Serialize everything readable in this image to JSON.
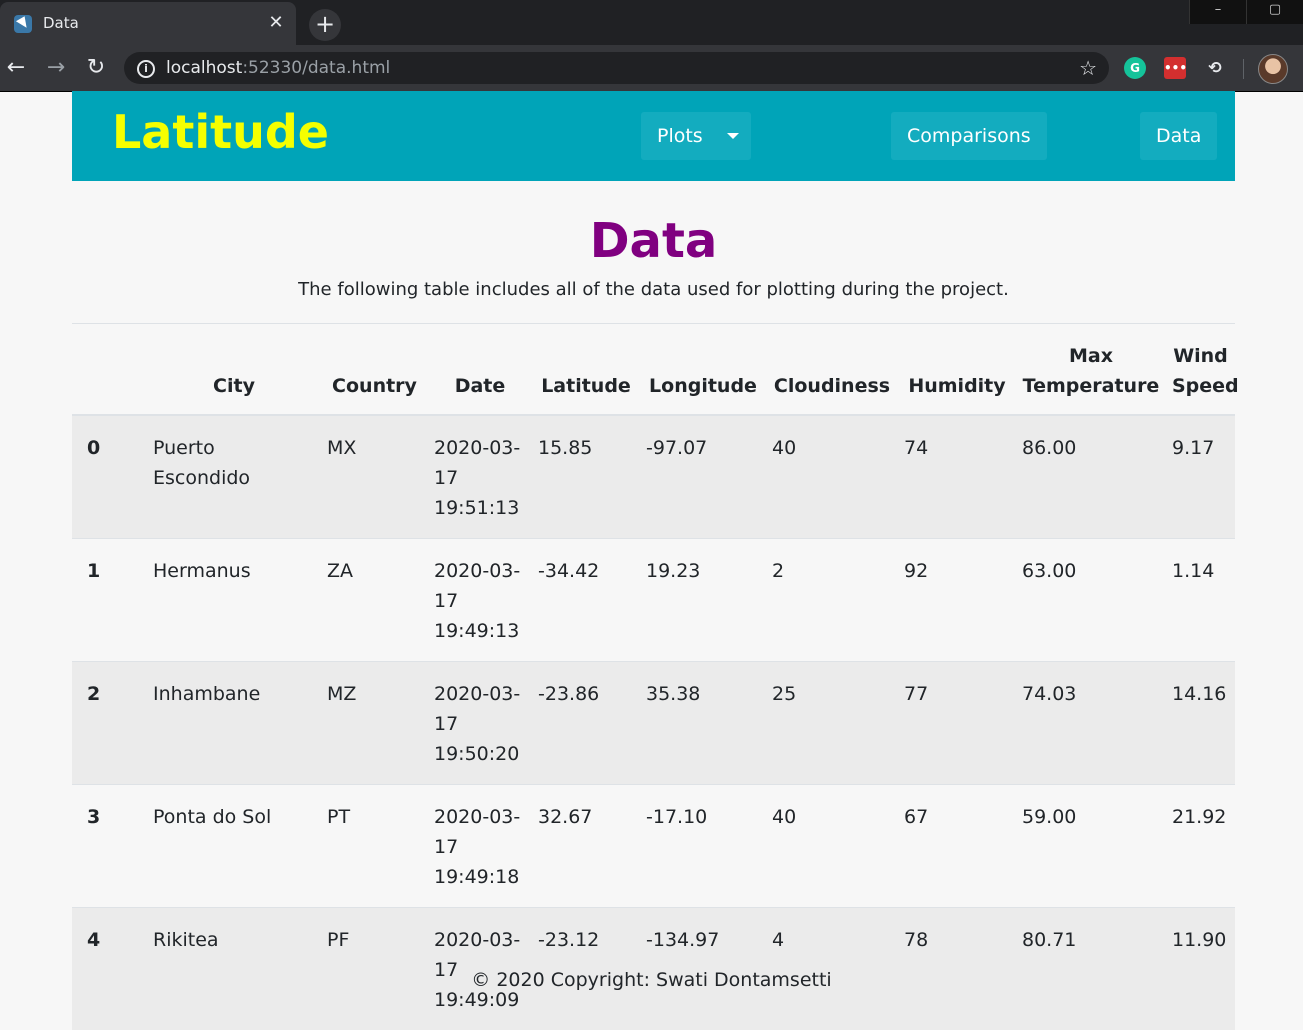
{
  "browser": {
    "tab_title": "Data",
    "close_glyph": "✕",
    "newtab_glyph": "+",
    "url_host": "localhost",
    "url_rest": ":52330/data.html"
  },
  "navbar": {
    "brand": "Latitude",
    "items": [
      {
        "label": "Plots"
      },
      {
        "label": "Comparisons"
      },
      {
        "label": "Data"
      }
    ]
  },
  "main": {
    "title": "Data",
    "lead": "The following table includes all of the data used for plotting during the project."
  },
  "table": {
    "headers": [
      "",
      "City",
      "Country",
      "Date",
      "Latitude",
      "Longitude",
      "Cloudiness",
      "Humidity",
      "Max Temperature",
      "Wind Speed"
    ],
    "rows": [
      [
        "0",
        "Puerto Escondido",
        "MX",
        "2020-03-17 19:51:13",
        "15.85",
        "-97.07",
        "40",
        "74",
        "86.00",
        "9.17"
      ],
      [
        "1",
        "Hermanus",
        "ZA",
        "2020-03-17 19:49:13",
        "-34.42",
        "19.23",
        "2",
        "92",
        "63.00",
        "1.14"
      ],
      [
        "2",
        "Inhambane",
        "MZ",
        "2020-03-17 19:50:20",
        "-23.86",
        "35.38",
        "25",
        "77",
        "74.03",
        "14.16"
      ],
      [
        "3",
        "Ponta do Sol",
        "PT",
        "2020-03-17 19:49:18",
        "32.67",
        "-17.10",
        "40",
        "67",
        "59.00",
        "21.92"
      ],
      [
        "4",
        "Rikitea",
        "PF",
        "2020-03-17 19:49:09",
        "-23.12",
        "-134.97",
        "4",
        "78",
        "80.71",
        "11.90"
      ]
    ]
  },
  "footer": {
    "text": "© 2020 Copyright: Swati Dontamsetti"
  },
  "colors": {
    "navbar": "#00a4b8",
    "brand": "#f5ff00",
    "heading": "#800080",
    "stripe": "#ebebeb"
  }
}
